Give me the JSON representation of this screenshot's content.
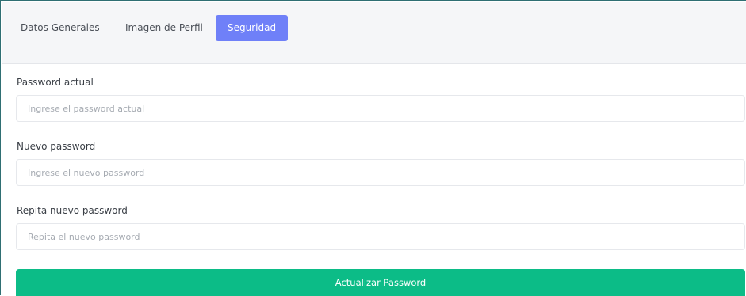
{
  "tabs": [
    {
      "label": "Datos Generales",
      "active": false
    },
    {
      "label": "Imagen de Perfil",
      "active": false
    },
    {
      "label": "Seguridad",
      "active": true
    }
  ],
  "form": {
    "current_password": {
      "label": "Password actual",
      "placeholder": "Ingrese el password actual",
      "value": ""
    },
    "new_password": {
      "label": "Nuevo password",
      "placeholder": "Ingrese el nuevo password",
      "value": ""
    },
    "repeat_password": {
      "label": "Repita nuevo password",
      "placeholder": "Repita el nuevo password",
      "value": ""
    },
    "submit_label": "Actualizar Password"
  },
  "colors": {
    "active_tab": "#6f80f8",
    "submit_button": "#0cbc87",
    "header_background": "#f5f6f8"
  }
}
